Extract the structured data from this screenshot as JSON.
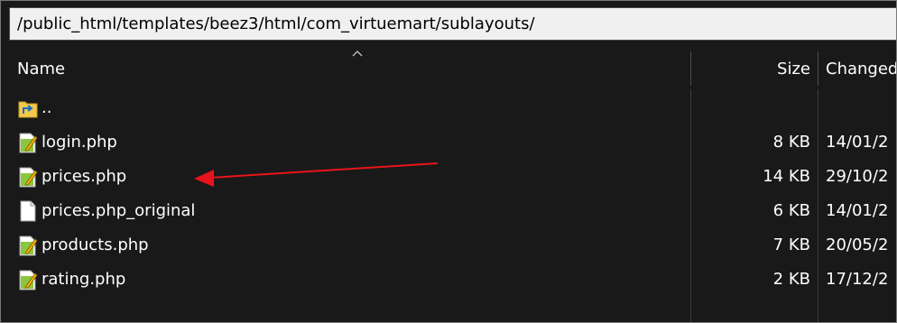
{
  "path_bar": {
    "value": "/public_html/templates/beez3/html/com_virtuemart/sublayouts/"
  },
  "columns": {
    "name": "Name",
    "size": "Size",
    "changed": "Changed"
  },
  "sort": {
    "column": "name",
    "direction": "ascending",
    "icon": "sort-up-icon"
  },
  "files": [
    {
      "name": "..",
      "size": "",
      "changed": "",
      "icon": "parent-folder-icon"
    },
    {
      "name": "login.php",
      "size": "8 KB",
      "changed": "14/01/2",
      "icon": "php-file-icon"
    },
    {
      "name": "prices.php",
      "size": "14 KB",
      "changed": "29/10/2",
      "icon": "php-file-icon"
    },
    {
      "name": "prices.php_original",
      "size": "6 KB",
      "changed": "14/01/2",
      "icon": "blank-file-icon"
    },
    {
      "name": "products.php",
      "size": "7 KB",
      "changed": "20/05/2",
      "icon": "php-file-icon"
    },
    {
      "name": "rating.php",
      "size": "2 KB",
      "changed": "17/12/2",
      "icon": "php-file-icon"
    }
  ],
  "annotation": {
    "type": "arrow",
    "color": "#e8141b",
    "points_to": "prices.php"
  },
  "colors": {
    "background": "#191919",
    "text": "#ffffff",
    "path_bar": "#f0f0f0",
    "arrow": "#e8141b"
  }
}
